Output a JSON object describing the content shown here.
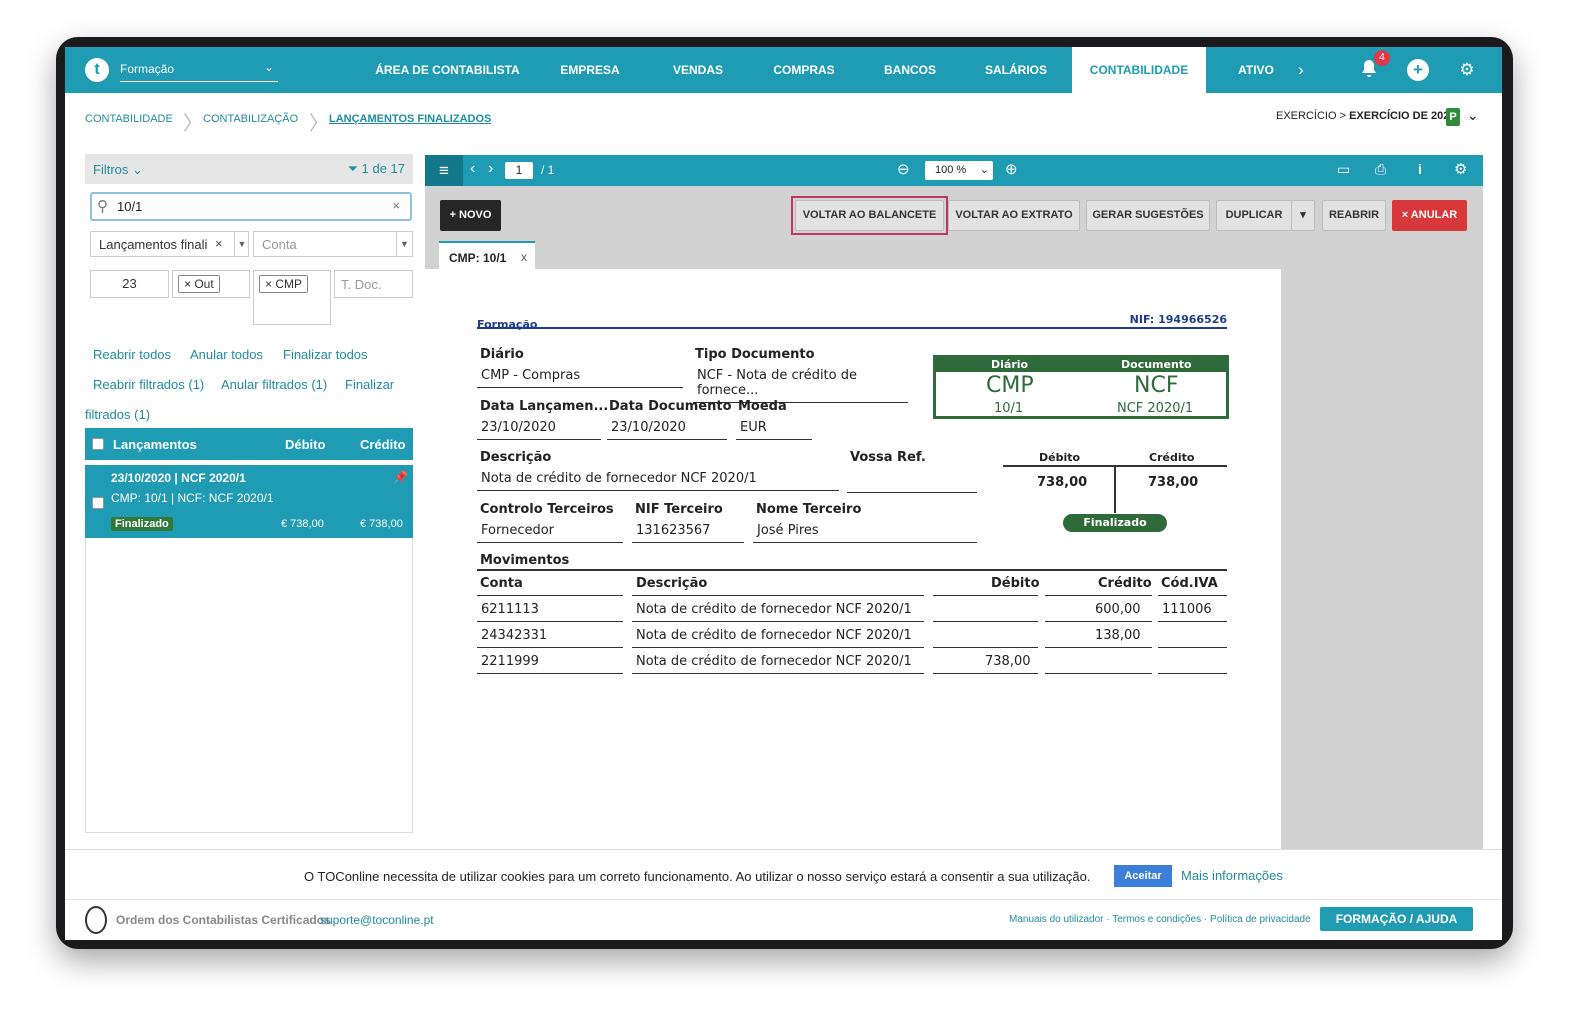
{
  "company": "Formação",
  "nav": [
    {
      "label": "ÁREA DE CONTABILISTA"
    },
    {
      "label": "EMPRESA"
    },
    {
      "label": "VENDAS"
    },
    {
      "label": "COMPRAS"
    },
    {
      "label": "BANCOS"
    },
    {
      "label": "SALÁRIOS"
    },
    {
      "label": "CONTABILIDADE"
    },
    {
      "label": "ATIVO"
    }
  ],
  "notifications_count": "4",
  "breadcrumb": {
    "b1": "CONTABILIDADE",
    "b2": "CONTABILIZAÇÃO",
    "b3": "LANÇAMENTOS FINALIZADOS"
  },
  "exercise": {
    "prefix": "EXERCÍCIO >",
    "value": "EXERCÍCIO DE 2020",
    "badge": "P"
  },
  "filters": {
    "label": "Filtros",
    "count": "1 de 17",
    "search": "10/1",
    "status_select": "Lançamentos finali",
    "account_placeholder": "Conta",
    "day": "23",
    "month_tag": "Out",
    "diary_tag": "CMP",
    "doc_placeholder": "T. Doc."
  },
  "actions": {
    "reopen_all": "Reabrir todos",
    "cancel_all": "Anular todos",
    "finalize_all": "Finalizar todos",
    "reopen_filtered": "Reabrir filtrados (1)",
    "cancel_filtered": "Anular filtrados (1)",
    "finalize_filtered_a": "Finalizar",
    "finalize_filtered_b": "filtrados (1)"
  },
  "list": {
    "headers": {
      "entries": "Lançamentos",
      "debit": "Débito",
      "credit": "Crédito"
    },
    "row": {
      "line1": "23/10/2020 | NCF 2020/1",
      "line2": "CMP: 10/1 | NCF: NCF 2020/1",
      "status": "Finalizado",
      "debit": "€ 738,00",
      "credit": "€ 738,00"
    }
  },
  "viewer": {
    "page": "1",
    "total": "/ 1",
    "zoom": "100 %"
  },
  "buttons": {
    "new": "+ NOVO",
    "back_balance": "VOLTAR AO BALANCETE",
    "back_statement": "VOLTAR AO EXTRATO",
    "suggestions": "GERAR SUGESTÕES",
    "duplicate": "DUPLICAR",
    "reopen": "REABRIR",
    "cancel": "× ANULAR"
  },
  "doc_tab": {
    "label": "CMP: 10/1",
    "close": "x"
  },
  "document": {
    "company": "Formação",
    "nif": "NIF: 194966526",
    "diary_label": "Diário",
    "diary_value": "CMP - Compras",
    "doctype_label": "Tipo Documento",
    "doctype_value": "NCF - Nota de crédito de fornece...",
    "stamp": {
      "h1": "Diário",
      "h2": "Documento",
      "big1": "CMP",
      "big2": "NCF",
      "small1": "10/1",
      "small2": "NCF 2020/1"
    },
    "date_label": "Data Lançamen...",
    "date_value": "23/10/2020",
    "docdate_label": "Data Documento",
    "docdate_value": "23/10/2020",
    "currency_label": "Moeda",
    "currency_value": "EUR",
    "desc_label": "Descrição",
    "desc_value": "Nota de crédito de fornecedor NCF 2020/1",
    "ref_label": "Vossa Ref.",
    "totals": {
      "debit_label": "Débito",
      "credit_label": "Crédito",
      "debit": "738,00",
      "credit": "738,00",
      "status": "Finalizado"
    },
    "third_label": "Controlo Terceiros",
    "third_value": "Fornecedor",
    "nif3_label": "NIF Terceiro",
    "nif3_value": "131623567",
    "name3_label": "Nome Terceiro",
    "name3_value": "José Pires",
    "movements_label": "Movimentos",
    "mov_headers": {
      "account": "Conta",
      "desc": "Descrição",
      "debit": "Débito",
      "credit": "Crédito",
      "vat": "Cód.IVA"
    },
    "movements": [
      {
        "account": "6211113",
        "desc": "Nota de crédito de fornecedor NCF 2020/1",
        "debit": "",
        "credit": "600,00",
        "vat": "111006"
      },
      {
        "account": "24342331",
        "desc": "Nota de crédito de fornecedor NCF 2020/1",
        "debit": "",
        "credit": "138,00",
        "vat": ""
      },
      {
        "account": "2211999",
        "desc": "Nota de crédito de fornecedor NCF 2020/1",
        "debit": "738,00",
        "credit": "",
        "vat": ""
      }
    ]
  },
  "cookie": {
    "text": "O TOConline necessita de utilizar cookies para um correto funcionamento. Ao utilizar o nosso serviço estará a consentir a sua utilização.",
    "accept": "Aceitar",
    "more": "Mais informações"
  },
  "footer": {
    "org": "Ordem dos Contabilistas Certificados",
    "email": "suporte@toconline.pt",
    "links": "Manuais do utilizador · Termos e condições · Política de privacidade",
    "help": "FORMAÇÃO / AJUDA"
  },
  "colors": {
    "brand": "#1f9bb3",
    "danger": "#d9383a",
    "success": "#2f6b3a",
    "highlight": "#c2336a"
  }
}
